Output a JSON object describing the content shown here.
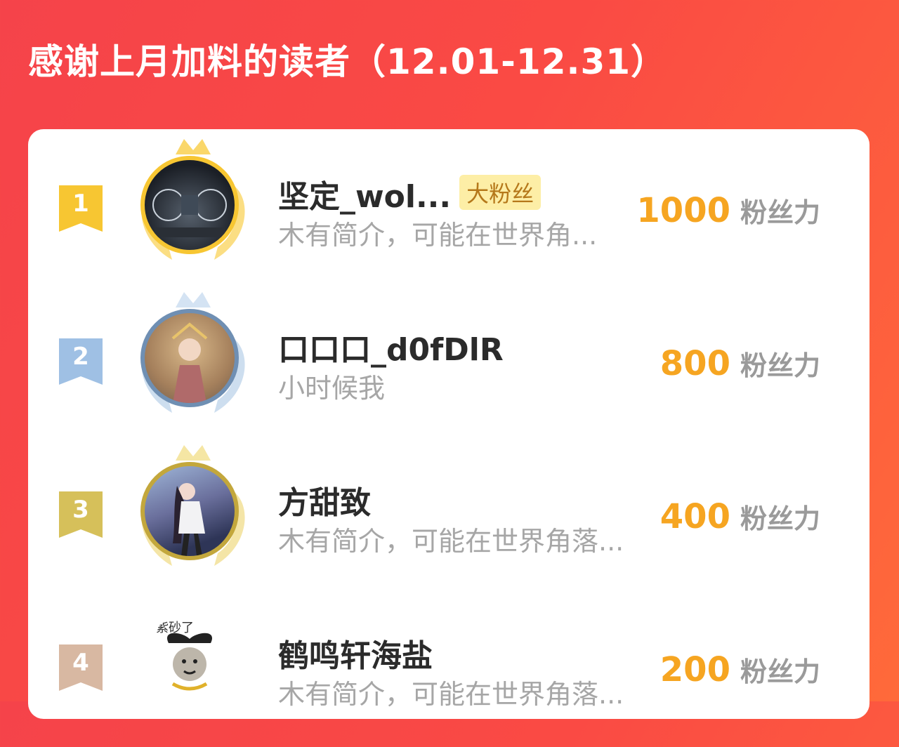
{
  "title": "感谢上月加料的读者（12.01-12.31）",
  "readers": [
    {
      "rank": "1",
      "name": "坚定_wol...",
      "badge": "大粉丝",
      "desc": "木有简介，可能在世界角...",
      "score": "1000",
      "unit": "粉丝力"
    },
    {
      "rank": "2",
      "name": "口口口_d0fDlR",
      "desc": "小时候我",
      "score": "800",
      "unit": "粉丝力"
    },
    {
      "rank": "3",
      "name": "方甜致",
      "desc": "木有简介，可能在世界角落...",
      "score": "400",
      "unit": "粉丝力"
    },
    {
      "rank": "4",
      "name": "鹤鸣轩海盐",
      "desc": "木有简介，可能在世界角落...",
      "score": "200",
      "unit": "粉丝力",
      "avatar_caption": "紫砂了"
    }
  ],
  "colors": {
    "rank1": "#f7c632",
    "rank2": "#9fc0e4",
    "rank3": "#d6c05a",
    "rank4": "#d8b8a2",
    "score": "#f6a521",
    "background": "#f5434a"
  }
}
